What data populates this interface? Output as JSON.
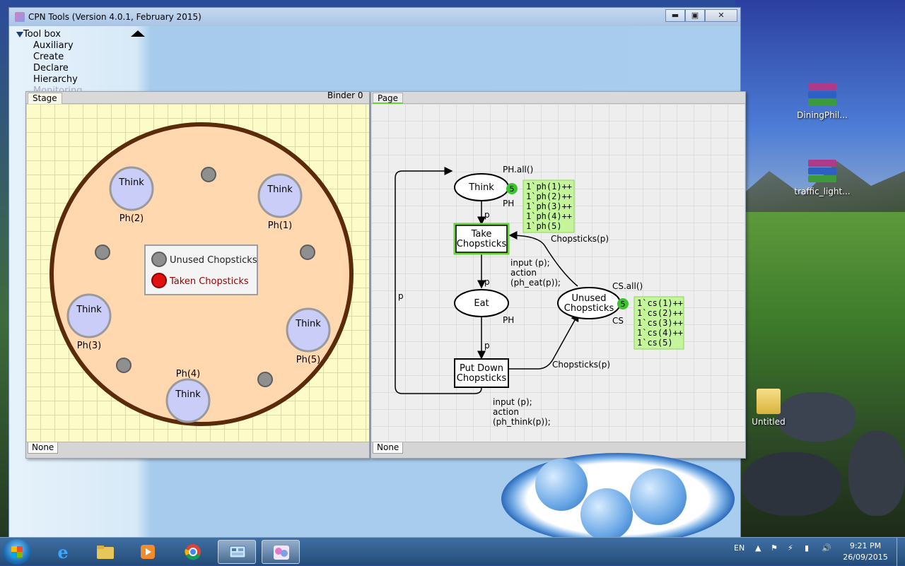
{
  "window": {
    "title": "CPN Tools (Version 4.0.1, February 2015)",
    "min_label": "▬",
    "max_label": "▣",
    "close_label": "✕"
  },
  "toolbox": {
    "header": "Tool box",
    "items": [
      "Auxiliary",
      "Create",
      "Declare",
      "Hierarchy",
      "Monitoring"
    ]
  },
  "binder": {
    "label": "Binder 0"
  },
  "stage": {
    "tab": "Stage",
    "footer_tab": "None",
    "philosophers": [
      {
        "state": "Think",
        "label": "Ph(2)"
      },
      {
        "state": "Think",
        "label": "Ph(1)"
      },
      {
        "state": "Think",
        "label": "Ph(3)"
      },
      {
        "state": "Think",
        "label": "Ph(5)"
      },
      {
        "state": "Think",
        "label": "Ph(4)"
      }
    ],
    "legend": {
      "unused": "Unused Chopsticks",
      "taken": "Taken Chopsticks",
      "unused_color": "#8f8f8f",
      "taken_color": "#e01010"
    },
    "colors": {
      "table": "#ffd8b0",
      "table_border": "#5a2a0a",
      "philosopher": "#c9cdf7"
    }
  },
  "page": {
    "tab": "Page",
    "footer_tab": "None",
    "net": {
      "place_think": "Think",
      "place_think_init": "PH.all()",
      "place_think_type": "PH",
      "think_count": "5",
      "think_marking": [
        "1`ph(1)++",
        "1`ph(2)++",
        "1`ph(3)++",
        "1`ph(4)++",
        "1`ph(5)"
      ],
      "trans_take_line1": "Take",
      "trans_take_line2": "Chopsticks",
      "take_guard_1": "input (p);",
      "take_guard_2": "action",
      "take_guard_3": "(ph_eat(p));",
      "place_eat": "Eat",
      "place_eat_type": "PH",
      "trans_put_line1": "Put Down",
      "trans_put_line2": "Chopsticks",
      "put_guard_1": "input (p);",
      "put_guard_2": "action",
      "put_guard_3": "(ph_think(p));",
      "place_unused_line1": "Unused",
      "place_unused_line2": "Chopsticks",
      "place_unused_init": "CS.all()",
      "place_unused_type": "CS",
      "unused_count": "5",
      "unused_marking": [
        "1`cs(1)++",
        "1`cs(2)++",
        "1`cs(3)++",
        "1`cs(4)++",
        "1`cs(5)"
      ],
      "arc_p1": "p",
      "arc_p2": "p",
      "arc_p3": "p",
      "arc_p_loop": "p",
      "arc_chop1": "Chopsticks(p)",
      "arc_chop2": "Chopsticks(p)"
    },
    "colors": {
      "marking_bg": "#c5f59a",
      "token_count": "#3cc42e",
      "enabled_border": "#6bd33a"
    }
  },
  "desktop": {
    "icons": [
      "DiningPhil...",
      "traffic_light...",
      "Untitled"
    ]
  },
  "taskbar": {
    "lang": "EN",
    "time": "9:21 PM",
    "date": "26/09/2015"
  }
}
